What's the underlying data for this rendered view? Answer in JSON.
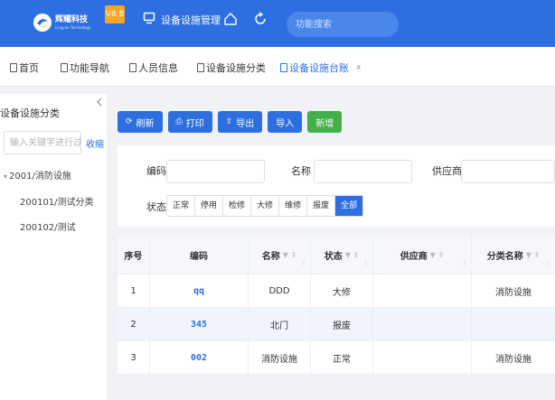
{
  "header": {
    "logo_name": "辉耀科技",
    "logo_sub": "Lingyao Technology",
    "version": "V8.8",
    "system_title": "设备设施管理",
    "search_placeholder": "功能搜索",
    "brand_color": "#2d6fe0"
  },
  "tabs": [
    {
      "label": "首页",
      "active": false
    },
    {
      "label": "功能导航",
      "active": false
    },
    {
      "label": "人员信息",
      "active": false
    },
    {
      "label": "设备设施分类",
      "active": false
    },
    {
      "label": "设备设施台账",
      "active": true,
      "close": "x"
    }
  ],
  "sidebar": {
    "title": "设备设施分类",
    "collapse_icon": "chevron-left-icon",
    "search_placeholder": "输入关键字进行过",
    "fold_label": "收缩",
    "tree": [
      {
        "label": "2001/消防设施",
        "caret": "▾"
      },
      {
        "label": "200101/测试分类"
      },
      {
        "label": "200102/测试"
      }
    ]
  },
  "toolbar": {
    "refresh": "刷新",
    "print": "打印",
    "export": "导出",
    "import": "导入",
    "add": "新增"
  },
  "filter": {
    "code_label": "编码",
    "name_label": "名称",
    "supplier_label": "供应商",
    "status_label": "状态",
    "status_options": [
      "正常",
      "停用",
      "检修",
      "大修",
      "维修",
      "报废",
      "全部"
    ],
    "status_selected": "全部"
  },
  "table": {
    "columns": [
      "序号",
      "编码",
      "名称",
      "状态",
      "供应商",
      "分类名称"
    ],
    "rows": [
      [
        "1",
        "qq",
        "DDD",
        "大修",
        "",
        "消防设施"
      ],
      [
        "2",
        "345",
        "北门",
        "报废",
        "",
        ""
      ],
      [
        "3",
        "002",
        "消防设施",
        "正常",
        "",
        "消防设施"
      ]
    ]
  }
}
